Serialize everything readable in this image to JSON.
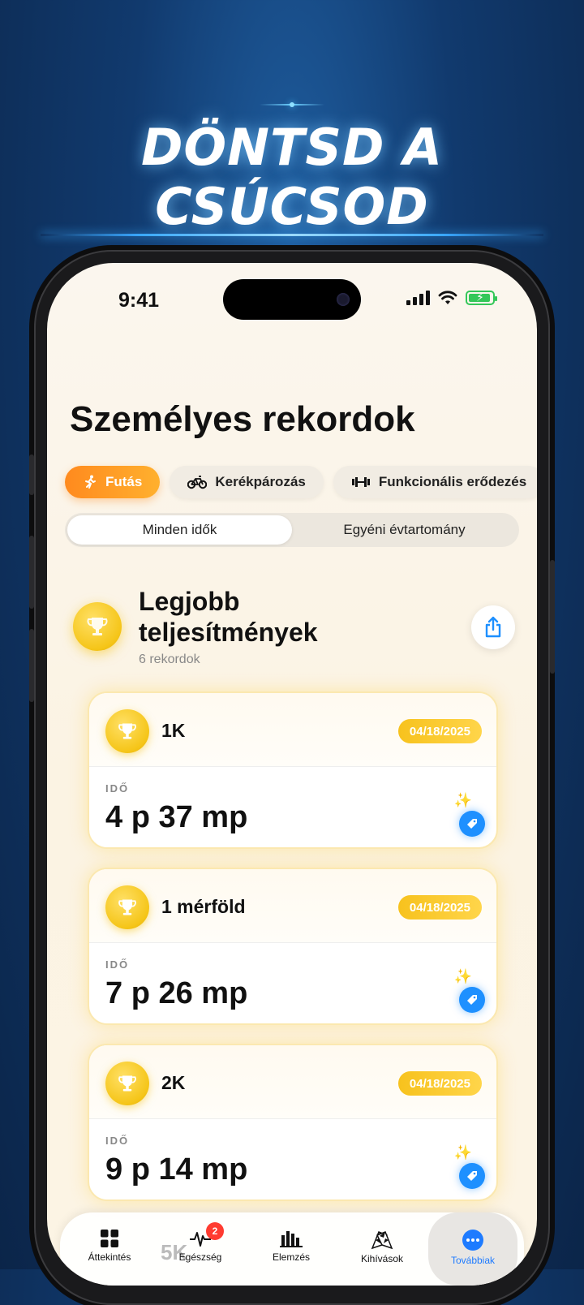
{
  "promo": {
    "headline": "DÖNTSD A CSÚCSOD"
  },
  "status_bar": {
    "time": "9:41"
  },
  "page": {
    "title": "Személyes rekordok"
  },
  "sport_tabs": [
    {
      "label": "Futás",
      "icon": "running-icon",
      "active": true
    },
    {
      "label": "Kerékpározás",
      "icon": "bicycle-icon",
      "active": false
    },
    {
      "label": "Funkcionális erődezés",
      "icon": "dumbbell-icon",
      "active": false
    }
  ],
  "range_segments": [
    {
      "label": "Minden idők",
      "active": true
    },
    {
      "label": "Egyéni évtartomány",
      "active": false
    }
  ],
  "section": {
    "title": "Legjobb teljesítmények",
    "subtitle": "6 rekordok"
  },
  "records": [
    {
      "name": "1K",
      "date": "04/18/2025",
      "label": "IDŐ",
      "value": "4 p 37 mp"
    },
    {
      "name": "1 mérföld",
      "date": "04/18/2025",
      "label": "IDŐ",
      "value": "7 p 26 mp"
    },
    {
      "name": "2K",
      "date": "04/18/2025",
      "label": "IDŐ",
      "value": "9 p 14 mp"
    }
  ],
  "peek": {
    "text": "5K"
  },
  "bottom_nav": [
    {
      "label": "Áttekintés",
      "icon": "grid-icon"
    },
    {
      "label": "Egészség",
      "icon": "heartbeat-icon",
      "badge": "2"
    },
    {
      "label": "Elemzés",
      "icon": "bar-chart-icon"
    },
    {
      "label": "Kihívások",
      "icon": "checkered-flags-icon"
    },
    {
      "label": "Továbbiak",
      "icon": "more-icon",
      "active": true
    }
  ],
  "colors": {
    "accent_orange": "#ff8a1e",
    "gold": "#f5c518",
    "blue": "#1e90ff"
  }
}
